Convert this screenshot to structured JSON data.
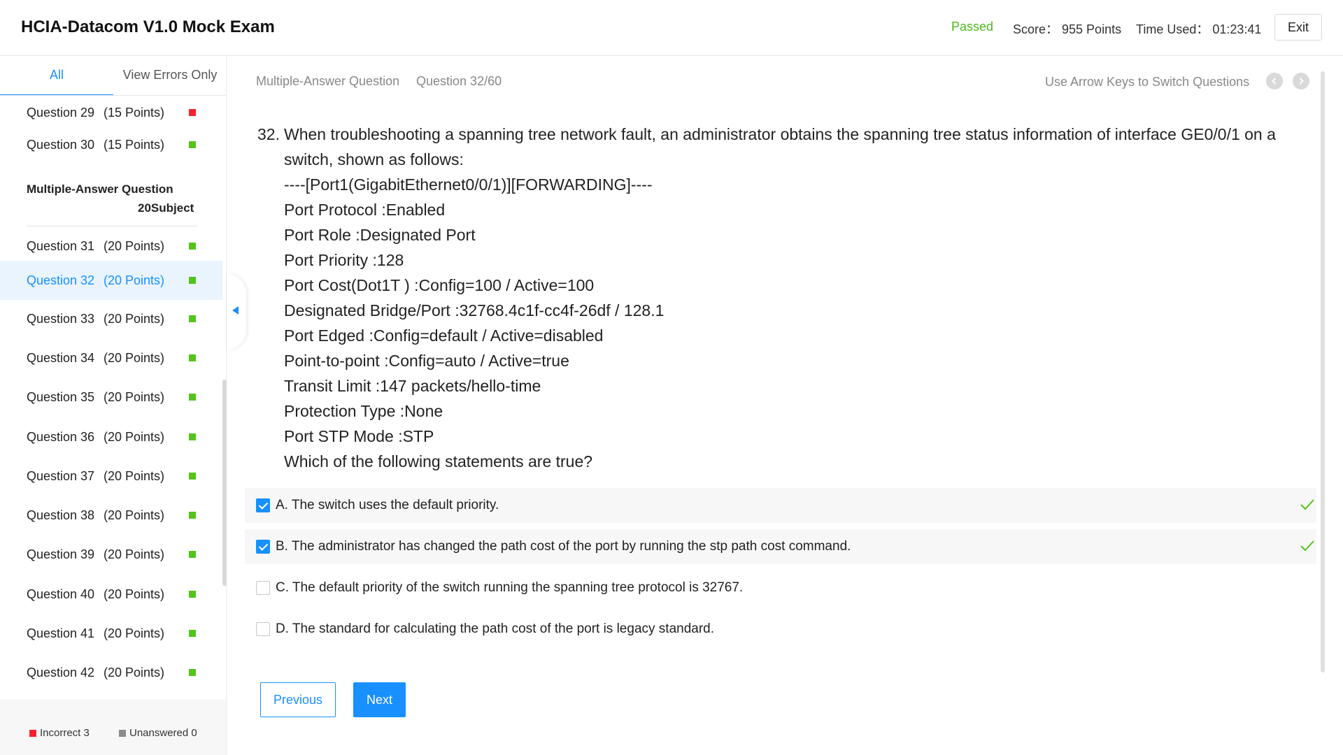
{
  "header": {
    "title": "HCIA-Datacom V1.0 Mock Exam",
    "status": "Passed",
    "score": "Score： 955 Points",
    "time_used": "Time Used： 01:23:41",
    "exit_label": "Exit"
  },
  "colors": {
    "accent": "#1890ff",
    "passed": "#52b51f",
    "correct": "#52c41a",
    "incorrect": "#f5222d",
    "unanswered": "#8c8c8c"
  },
  "sidebar": {
    "tabs": [
      {
        "label": "All",
        "active": true
      },
      {
        "label": "View Errors Only",
        "active": false
      }
    ],
    "items_before": [
      {
        "name": "Question 29",
        "points": "(15 Points)",
        "status": "incorrect"
      },
      {
        "name": "Question 30",
        "points": "(15 Points)",
        "status": "correct"
      }
    ],
    "section": {
      "title": "Multiple-Answer Question",
      "count": "20Subject"
    },
    "items": [
      {
        "name": "Question 31",
        "points": "(20 Points)",
        "status": "correct"
      },
      {
        "name": "Question 32",
        "points": "(20 Points)",
        "status": "correct",
        "active": true
      },
      {
        "name": "Question 33",
        "points": "(20 Points)",
        "status": "correct"
      },
      {
        "name": "Question 34",
        "points": "(20 Points)",
        "status": "correct"
      },
      {
        "name": "Question 35",
        "points": "(20 Points)",
        "status": "correct"
      },
      {
        "name": "Question 36",
        "points": "(20 Points)",
        "status": "correct"
      },
      {
        "name": "Question 37",
        "points": "(20 Points)",
        "status": "correct"
      },
      {
        "name": "Question 38",
        "points": "(20 Points)",
        "status": "correct"
      },
      {
        "name": "Question 39",
        "points": "(20 Points)",
        "status": "correct"
      },
      {
        "name": "Question 40",
        "points": "(20 Points)",
        "status": "correct"
      },
      {
        "name": "Question 41",
        "points": "(20 Points)",
        "status": "correct"
      },
      {
        "name": "Question 42",
        "points": "(20 Points)",
        "status": "correct"
      }
    ],
    "legend": {
      "incorrect": "Incorrect 3",
      "unanswered": "Unanswered 0"
    }
  },
  "main": {
    "question_type": "Multiple-Answer Question",
    "counter": "Question 32/60",
    "hint": "Use Arrow Keys to Switch Questions",
    "number": "32.",
    "lines": [
      "When troubleshooting a spanning tree network fault, an administrator obtains the spanning tree status information of interface GE0/0/1 on a",
      "switch, shown as follows:",
      "----[Port1(GigabitEthernet0/0/1)][FORWARDING]----",
      "Port Protocol :Enabled",
      "Port Role :Designated Port",
      "Port Priority :128",
      "Port Cost(Dot1T ) :Config=100 / Active=100",
      "Designated Bridge/Port :32768.4c1f-cc4f-26df / 128.1",
      "Port Edged :Config=default / Active=disabled",
      "Point-to-point :Config=auto / Active=true",
      "Transit Limit :147 packets/hello-time",
      "Protection Type :None",
      "Port STP Mode :STP",
      "Which of the following statements are true?"
    ],
    "options": [
      {
        "text": "A. The switch uses the default priority.",
        "checked": true,
        "correct": true
      },
      {
        "text": "B. The administrator has changed the path cost of the port by running the stp path cost command.",
        "checked": true,
        "correct": true
      },
      {
        "text": "C. The default priority of the switch running the spanning tree protocol is 32767.",
        "checked": false,
        "correct": false
      },
      {
        "text": "D. The standard for calculating the path cost of the port is legacy standard.",
        "checked": false,
        "correct": false
      }
    ],
    "prev_label": "Previous",
    "next_label": "Next"
  }
}
